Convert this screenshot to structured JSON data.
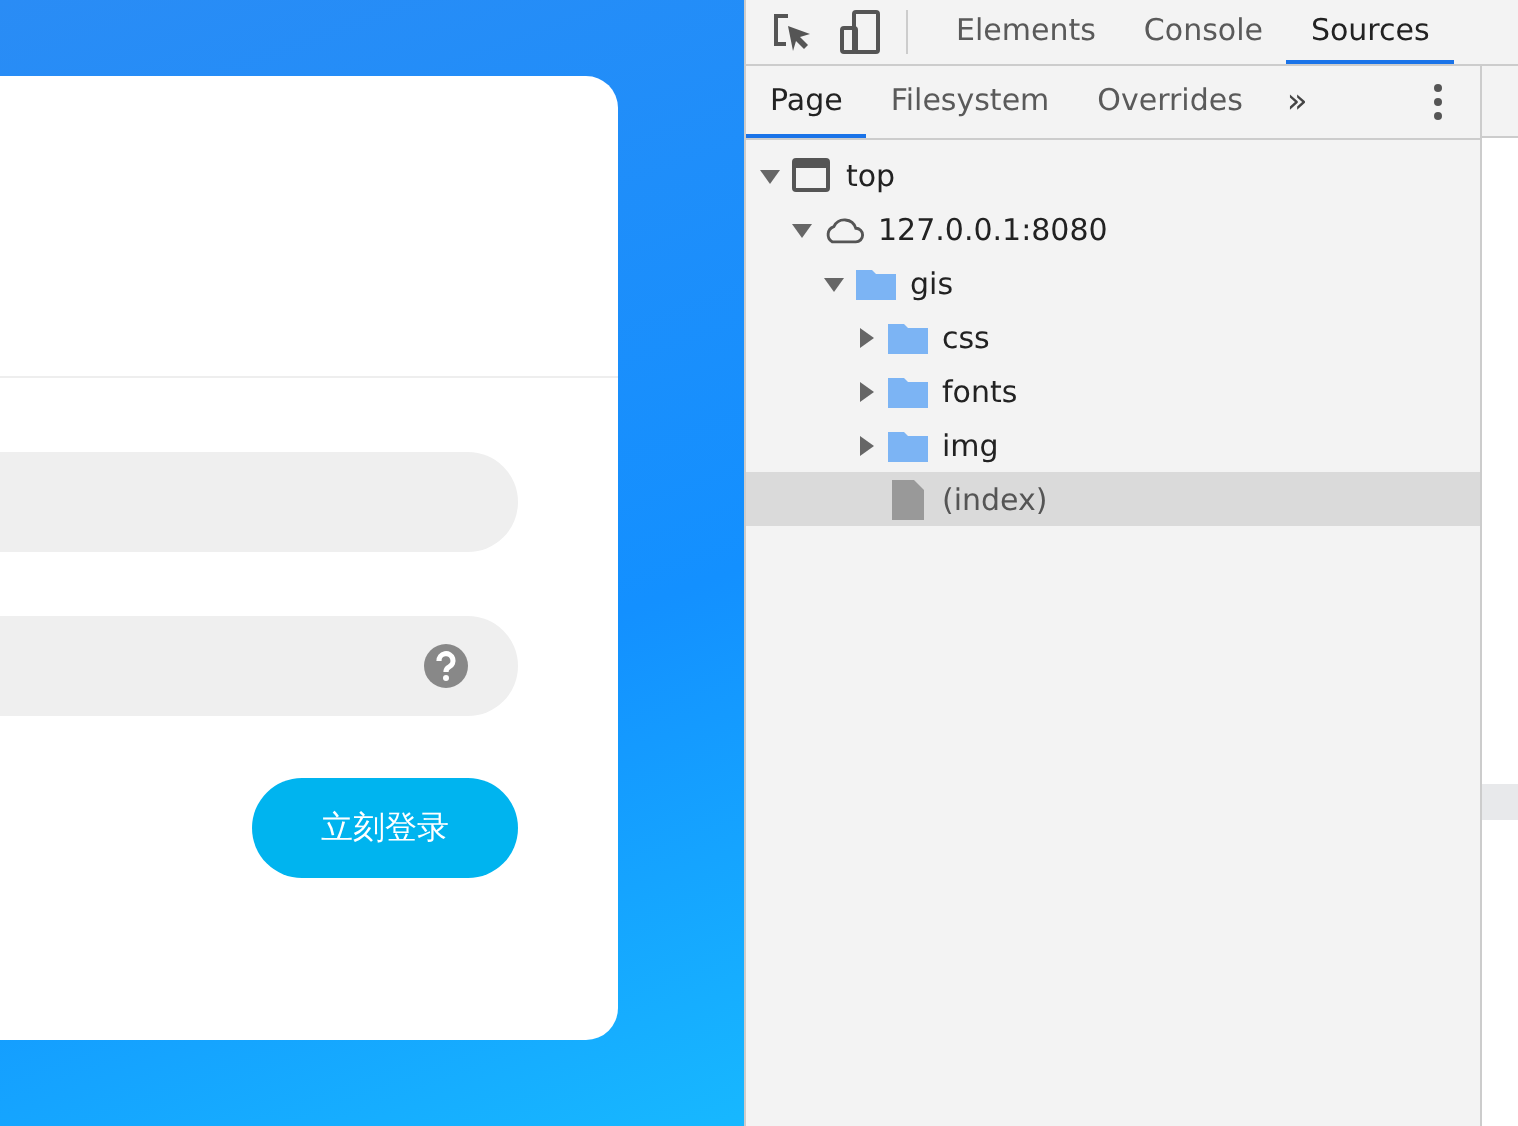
{
  "login": {
    "submit_button": "立刻登录"
  },
  "devtools": {
    "tabs": [
      {
        "label": "Elements",
        "selected": false
      },
      {
        "label": "Console",
        "selected": false
      },
      {
        "label": "Sources",
        "selected": true
      }
    ],
    "subtabs": [
      {
        "label": "Page",
        "selected": true
      },
      {
        "label": "Filesystem",
        "selected": false
      },
      {
        "label": "Overrides",
        "selected": false
      }
    ],
    "more_tabs": "»",
    "tree": [
      {
        "label": "top",
        "kind": "frame",
        "expanded": true,
        "selected": false,
        "children": [
          {
            "label": "127.0.0.1:8080",
            "kind": "origin",
            "expanded": true,
            "selected": false,
            "children": [
              {
                "label": "gis",
                "kind": "folder",
                "expanded": true,
                "selected": false,
                "children": [
                  {
                    "label": "css",
                    "kind": "folder",
                    "expanded": false,
                    "selected": false
                  },
                  {
                    "label": "fonts",
                    "kind": "folder",
                    "expanded": false,
                    "selected": false
                  },
                  {
                    "label": "img",
                    "kind": "folder",
                    "expanded": false,
                    "selected": false
                  },
                  {
                    "label": "(index)",
                    "kind": "file",
                    "selected": true
                  }
                ]
              }
            ]
          }
        ]
      }
    ]
  }
}
